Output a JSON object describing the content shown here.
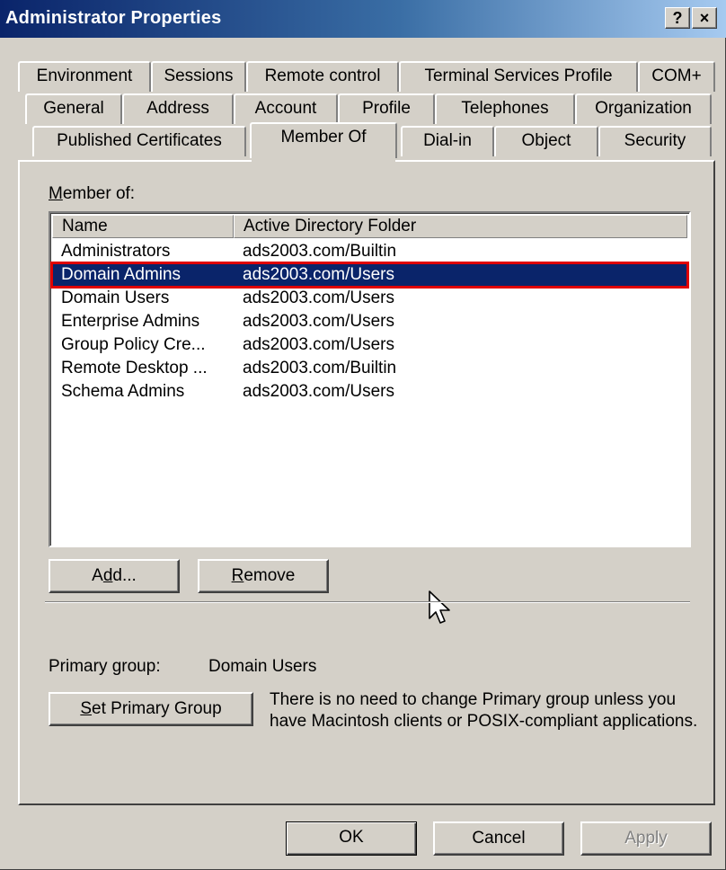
{
  "window": {
    "title": "Administrator Properties",
    "help_glyph": "?",
    "close_glyph": "×"
  },
  "tabs": {
    "row1": [
      "Environment",
      "Sessions",
      "Remote control",
      "Terminal Services Profile",
      "COM+"
    ],
    "row2": [
      "General",
      "Address",
      "Account",
      "Profile",
      "Telephones",
      "Organization"
    ],
    "row3": [
      "Published Certificates",
      "Member Of",
      "Dial-in",
      "Object",
      "Security"
    ],
    "active": "Member Of"
  },
  "member_of": {
    "label_prefix": "M",
    "label_rest": "ember of:",
    "columns": [
      "Name",
      "Active Directory Folder"
    ],
    "rows": [
      {
        "name": "Administrators",
        "folder": "ads2003.com/Builtin"
      },
      {
        "name": "Domain Admins",
        "folder": "ads2003.com/Users"
      },
      {
        "name": "Domain Users",
        "folder": "ads2003.com/Users"
      },
      {
        "name": "Enterprise Admins",
        "folder": "ads2003.com/Users"
      },
      {
        "name": "Group Policy Cre...",
        "folder": "ads2003.com/Users"
      },
      {
        "name": "Remote Desktop ...",
        "folder": "ads2003.com/Builtin"
      },
      {
        "name": "Schema Admins",
        "folder": "ads2003.com/Users"
      }
    ],
    "selected_row": "Domain Admins"
  },
  "buttons": {
    "add": {
      "pre": "A",
      "ul": "d",
      "post": "d..."
    },
    "remove": {
      "ul": "R",
      "post": "emove"
    },
    "set_primary": {
      "ul": "S",
      "post": "et Primary Group"
    },
    "ok": "OK",
    "cancel": "Cancel",
    "apply": "Apply"
  },
  "primary_group": {
    "label": "Primary group:",
    "value": "Domain Users",
    "description": "There is no need to change Primary group unless you have Macintosh clients or POSIX-compliant applications."
  },
  "colors": {
    "title_start": "#0a246a",
    "title_end": "#a6caf0",
    "selection": "#0a246a",
    "highlight_outline": "#e00000",
    "face": "#d4d0c8"
  },
  "icons": {
    "cursor": "arrow-cursor-icon"
  }
}
